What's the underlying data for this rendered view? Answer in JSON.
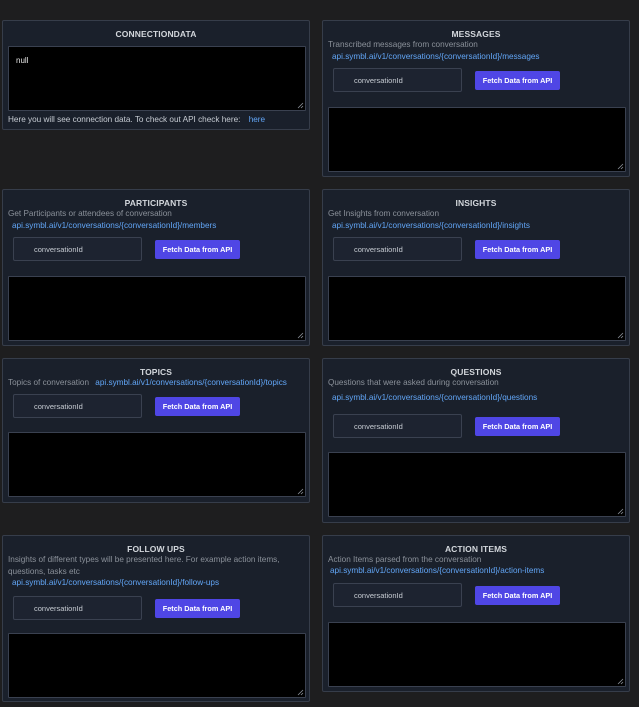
{
  "connection": {
    "title": "CONNECTIONDATA",
    "value": "null",
    "note": "Here you will see connection data. To check out API check here:",
    "link": "here"
  },
  "messages": {
    "title": "MESSAGES",
    "desc": "Transcribed messages from conversation",
    "endpoint": "api.symbl.ai/v1/conversations/{conversationId}/messages",
    "placeholder": "conversationId",
    "button": "Fetch Data from API"
  },
  "participants": {
    "title": "PARTICIPANTS",
    "desc": "Get Participants or attendees of conversation",
    "endpoint": "api.symbl.ai/v1/conversations/{conversationId}/members",
    "placeholder": "conversationId",
    "button": "Fetch Data from API"
  },
  "insights": {
    "title": "INSIGHTS",
    "desc": "Get Insights from conversation",
    "endpoint": "api.symbl.ai/v1/conversations/{conversationId}/insights",
    "placeholder": "conversationId",
    "button": "Fetch Data from API"
  },
  "topics": {
    "title": "TOPICS",
    "desc": "Topics of conversation",
    "endpoint": "api.symbl.ai/v1/conversations/{conversationId}/topics",
    "placeholder": "conversationId",
    "button": "Fetch Data from API"
  },
  "questions": {
    "title": "QUESTIONS",
    "desc": "Questions that were asked during conversation",
    "endpoint": "api.symbl.ai/v1/conversations/{conversationId}/questions",
    "placeholder": "conversationId",
    "button": "Fetch Data from API"
  },
  "followups": {
    "title": "FOLLOW UPS",
    "desc": "Insights of different types will be presented here. For example action items, questions, tasks etc",
    "endpoint": "api.symbl.ai/v1/conversations/{conversationId}/follow-ups",
    "placeholder": "conversationId",
    "button": "Fetch Data from API"
  },
  "actionitems": {
    "title": "ACTION ITEMS",
    "desc": "Action Items parsed from the conversation",
    "endpoint": "api.symbl.ai/v1/conversations/{conversationId}/action-items",
    "placeholder": "conversationId",
    "button": "Fetch Data from API"
  }
}
